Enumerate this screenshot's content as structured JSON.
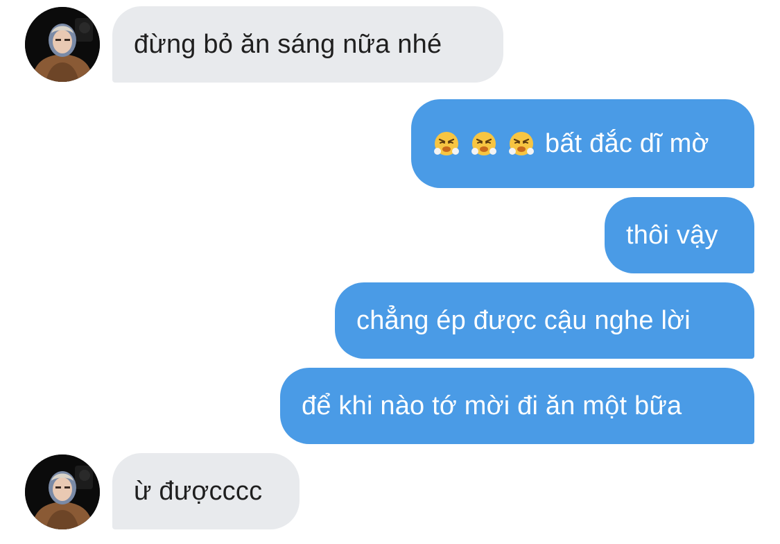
{
  "conversation": {
    "messages": [
      {
        "sender": "incoming",
        "text": "đừng bỏ ăn sáng nữa nhé"
      },
      {
        "sender": "outgoing",
        "emojis": [
          "face-with-steam-from-nose",
          "face-with-steam-from-nose",
          "face-with-steam-from-nose"
        ],
        "text": "bất đắc dĩ mờ"
      },
      {
        "sender": "outgoing",
        "text": "thôi vậy"
      },
      {
        "sender": "outgoing",
        "text": "chẳng ép được cậu nghe lời"
      },
      {
        "sender": "outgoing",
        "text": "để khi nào tớ mời đi ăn một bữa"
      },
      {
        "sender": "incoming",
        "text": "ừ đượcccc"
      }
    ]
  },
  "colors": {
    "incoming_bubble": "#e8eaed",
    "outgoing_bubble": "#4a9be6",
    "incoming_text": "#1f1f1f",
    "outgoing_text": "#ffffff",
    "background": "#ffffff"
  },
  "icons": {
    "avatar": "profile-photo",
    "emoji": "face-with-steam-from-nose"
  }
}
